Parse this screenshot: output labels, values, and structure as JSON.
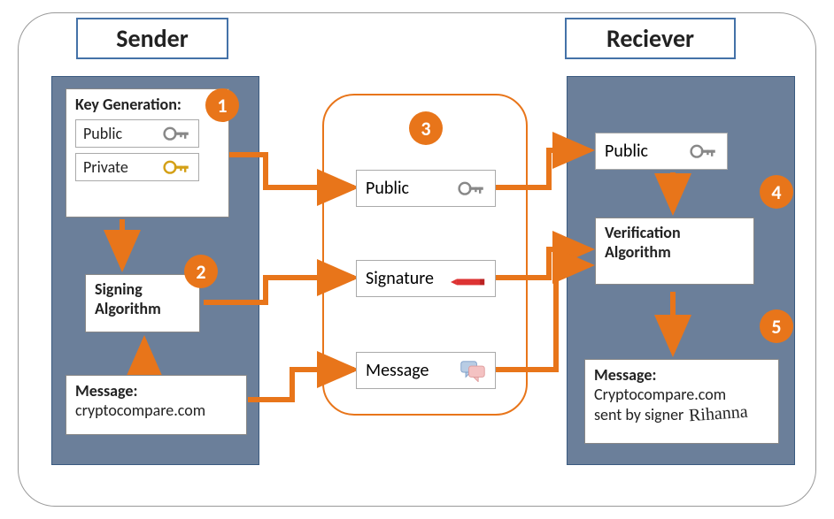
{
  "titles": {
    "sender": "Sender",
    "receiver": "Reciever"
  },
  "sender": {
    "keygen_heading": "Key Generation:",
    "public_label": "Public",
    "private_label": "Private",
    "signing_algo": "Signing Algorithm",
    "message_heading": "Message:",
    "message_value": "cryptocompare.com"
  },
  "transit": {
    "public": "Public",
    "signature": "Signature",
    "message": "Message"
  },
  "receiver": {
    "public_label": "Public",
    "verification_algo": "Verification Algorithm",
    "message_heading": "Message:",
    "message_line1": "Cryptocompare.com",
    "message_line2": "sent by signer"
  },
  "steps": {
    "s1": "1",
    "s2": "2",
    "s3": "3",
    "s4": "4",
    "s5": "5"
  },
  "colors": {
    "panel": "#6b7f9a",
    "accent": "#e8751a",
    "border_blue": "#4472a8"
  }
}
